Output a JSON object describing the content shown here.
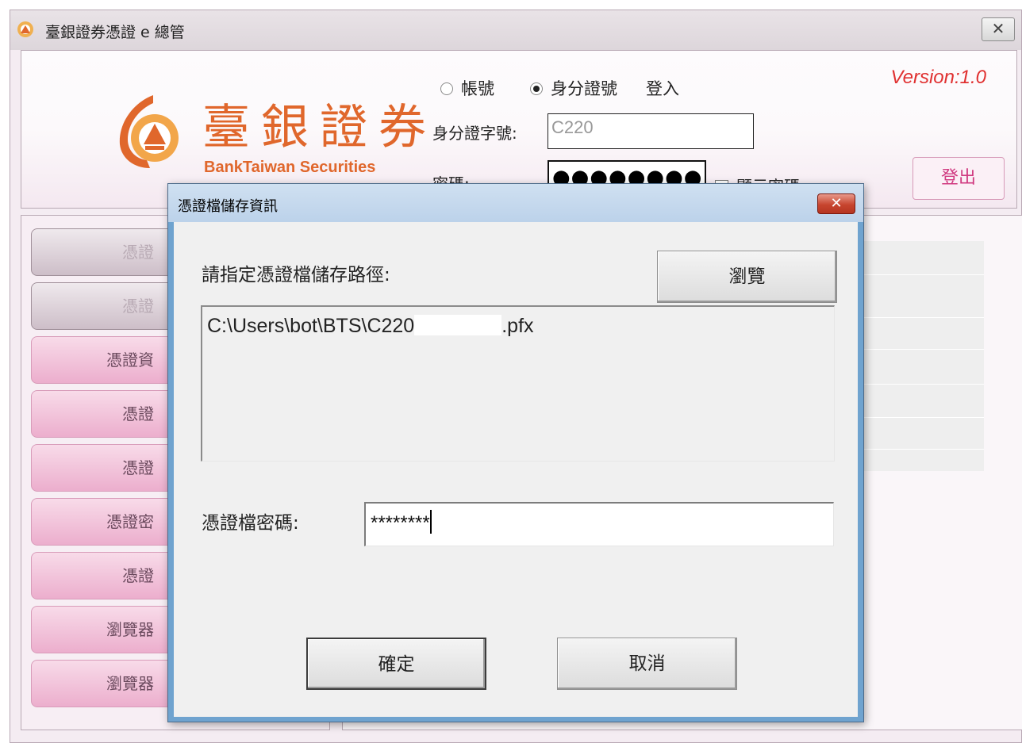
{
  "window": {
    "title": "臺銀證券憑證 e 總管",
    "close_glyph": "✕"
  },
  "header": {
    "logo_cn": "臺銀證券",
    "logo_en": "BankTaiwan Securities",
    "login_mode": {
      "account_label": "帳號",
      "id_label": "身分證號",
      "selected": "身分證號",
      "suffix": "登入"
    },
    "version": "Version:1.0",
    "id_field": {
      "label": "身分證字號:",
      "value": "C220"
    },
    "password_field": {
      "label": "密碼:",
      "value": "●●●●●●●●"
    },
    "show_password_label": "顯示密碼",
    "logout_label": "登出"
  },
  "nav": {
    "items": [
      {
        "label": "憑證",
        "style": "gray"
      },
      {
        "label": "憑證",
        "style": "gray"
      },
      {
        "label": "憑證資",
        "style": "pink"
      },
      {
        "label": "憑證",
        "style": "pink"
      },
      {
        "label": "憑證",
        "style": "pink"
      },
      {
        "label": "憑證密",
        "style": "pink"
      },
      {
        "label": "憑證",
        "style": "pink"
      },
      {
        "label": "瀏覽器",
        "style": "pink"
      },
      {
        "label": "瀏覽器",
        "style": "pink"
      }
    ]
  },
  "dialog": {
    "title": "憑證檔儲存資訊",
    "close_glyph": "✕",
    "path_label": "請指定憑證檔儲存路徑:",
    "browse_label": "瀏覽",
    "path_value": "C:\\Users\\bot\\BTS\\C220",
    "path_ext": ".pfx",
    "password_label": "憑證檔密碼:",
    "password_value": "********",
    "ok_label": "確定",
    "cancel_label": "取消"
  },
  "colors": {
    "brand_orange": "#e0672c",
    "version_red": "#e03030",
    "logout_pink": "#d03a80",
    "nav_pink": "#f3c3dc",
    "dialog_frame": "#6fa3cf"
  },
  "icons": {
    "app": "bank-taiwan-logo-icon",
    "dialog_close": "close-icon"
  }
}
